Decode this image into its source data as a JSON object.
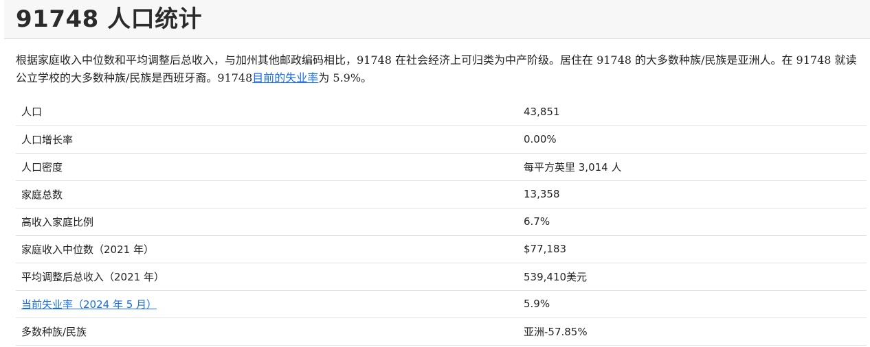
{
  "page": {
    "title": "91748 人口统计"
  },
  "intro": {
    "text_before_link": "根据家庭收入中位数和平均调整后总收入，与加州其他邮政编码相比，91748 在社会经济上可归类为中产阶级。居住在 91748 的大多数种族/民族是亚洲人。在 91748 就读公立学校的大多数种族/民族是西班牙裔。91748",
    "link_text": "目前的失业率",
    "text_after_link": "为 5.9%。"
  },
  "stats": {
    "rows": [
      {
        "label": "人口",
        "value": "43,851"
      },
      {
        "label": "人口增长率",
        "value": "0.00%"
      },
      {
        "label": "人口密度",
        "value": "每平方英里 3,014 人"
      },
      {
        "label": "家庭总数",
        "value": "13,358"
      },
      {
        "label": "高收入家庭比例",
        "value": "6.7%"
      },
      {
        "label": "家庭收入中位数（2021 年）",
        "value": "$77,183"
      },
      {
        "label": "平均调整后总收入（2021 年）",
        "value": "539,410美元"
      },
      {
        "label": "当前失业率（2024 年 5 月）",
        "value": "5.9%"
      },
      {
        "label": "多数种族/民族",
        "value": "亚洲-57.85%"
      }
    ]
  },
  "colors": {
    "link": "#1a6ee5",
    "header_bg": "#f7f7f7",
    "row_border": "#dee2e6"
  }
}
